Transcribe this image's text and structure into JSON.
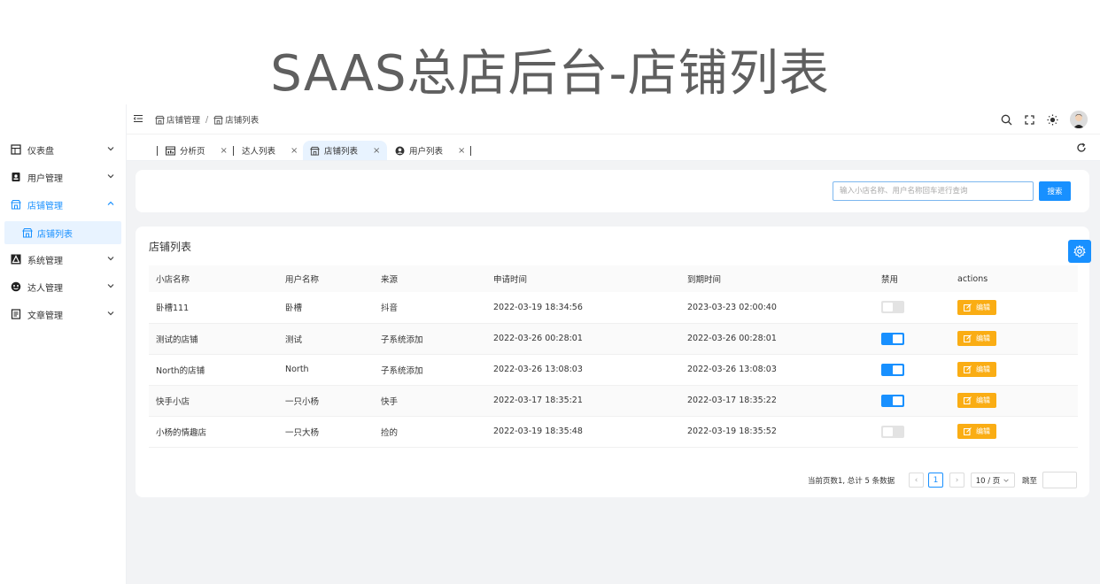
{
  "hero_title": "SAAS总店后台-店铺列表",
  "sidebar": {
    "items": [
      {
        "label": "仪表盘",
        "icon": "dashboard-icon"
      },
      {
        "label": "用户管理",
        "icon": "user-card-icon"
      },
      {
        "label": "店铺管理",
        "icon": "store-icon",
        "active": true
      },
      {
        "label": "系统管理",
        "icon": "system-icon"
      },
      {
        "label": "达人管理",
        "icon": "influencer-icon"
      },
      {
        "label": "文章管理",
        "icon": "article-icon"
      }
    ],
    "sub_item": {
      "label": "店铺列表",
      "icon": "store-icon"
    }
  },
  "header": {
    "breadcrumb": [
      "店铺管理",
      "店铺列表"
    ],
    "separator": "/",
    "tools": [
      "search-icon",
      "fullscreen-icon",
      "theme-icon",
      "avatar"
    ]
  },
  "tabs": [
    {
      "label": "分析页",
      "icon": "chart-icon",
      "close": "×"
    },
    {
      "label": "达人列表",
      "icon": "",
      "close": "×"
    },
    {
      "label": "店铺列表",
      "icon": "store-icon",
      "close": "×",
      "active": true
    },
    {
      "label": "用户列表",
      "icon": "user-icon",
      "close": "×"
    }
  ],
  "search": {
    "placeholder": "输入小店名称、用户名称回车进行查询",
    "button": "搜索"
  },
  "table": {
    "title": "店铺列表",
    "columns": [
      "小店名称",
      "用户名称",
      "来源",
      "申请时间",
      "到期时间",
      "禁用",
      "actions"
    ],
    "rows": [
      {
        "shop": "卧槽111",
        "user": "卧槽",
        "source": "抖音",
        "apply": "2022-03-19 18:34:56",
        "expire": "2023-03-23 02:00:40",
        "disabled": false
      },
      {
        "shop": "测试的店铺",
        "user": "测试",
        "source": "子系统添加",
        "apply": "2022-03-26 00:28:01",
        "expire": "2022-03-26 00:28:01",
        "disabled": true
      },
      {
        "shop": "North的店铺",
        "user": "North",
        "source": "子系统添加",
        "apply": "2022-03-26 13:08:03",
        "expire": "2022-03-26 13:08:03",
        "disabled": true
      },
      {
        "shop": "快手小店",
        "user": "一只小杨",
        "source": "快手",
        "apply": "2022-03-17 18:35:21",
        "expire": "2022-03-17 18:35:22",
        "disabled": true
      },
      {
        "shop": "小杨的情趣店",
        "user": "一只大杨",
        "source": "捡的",
        "apply": "2022-03-19 18:35:48",
        "expire": "2022-03-19 18:35:52",
        "disabled": false
      }
    ],
    "edit_label": "编辑"
  },
  "pagination": {
    "total_text": "当前页数1, 总计 5 条数据",
    "prev": "‹",
    "next": "›",
    "current_page": "1",
    "page_size": "10 / 页",
    "jump_label": "跳至"
  },
  "colors": {
    "primary": "#1890ff",
    "edit": "#faad14",
    "background": "#f2f3f5"
  }
}
